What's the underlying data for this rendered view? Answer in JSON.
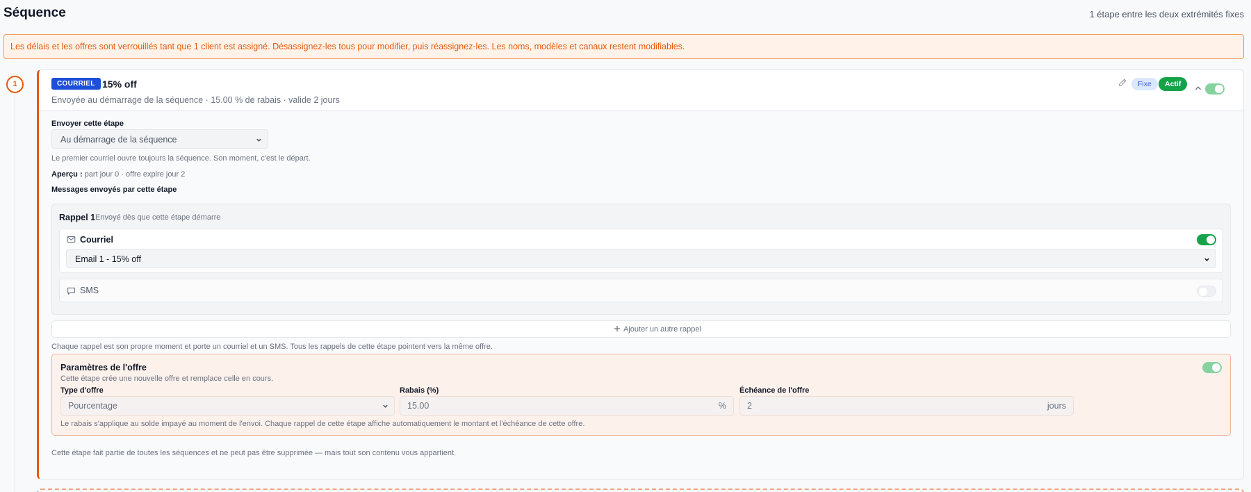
{
  "header": {
    "title": "Séquence",
    "meta": "1 étape entre les deux extrémités fixes"
  },
  "banner": {
    "text": "Les délais et les offres sont verrouillés tant que 1 client est assigné. Désassignez-les tous pour modifier, puis réassignez-les. Les noms, modèles et canaux restent modifiables."
  },
  "step": {
    "number": "1",
    "channel_badge": "COURRIEL",
    "title": "15% off",
    "subtitle": "Envoyée au démarrage de la séquence · 15.00 % de rabais · valide 2 jours",
    "tag_fixed": "Fixe",
    "tag_active": "Actif",
    "enabled": true,
    "send_label": "Envoyer cette étape",
    "send_select": "Au démarrage de la séquence",
    "send_hint": "Le premier courriel ouvre toujours la séquence. Son moment, c'est le départ.",
    "preview_label": "Aperçu :",
    "preview_value": "part jour 0 · offre expire jour 2",
    "messages_label": "Messages envoyés par cette étape",
    "rappel": {
      "title": "Rappel 1",
      "subtitle": "Envoyé dès que cette étape démarre",
      "email": {
        "label": "Courriel",
        "enabled": true,
        "template": "Email 1 - 15% off"
      },
      "sms": {
        "label": "SMS",
        "enabled": false
      }
    },
    "add_rappel": "Ajouter un autre rappel",
    "rappel_hint": "Chaque rappel est son propre moment et porte un courriel et un SMS. Tous les rappels de cette étape pointent vers la même offre.",
    "offer": {
      "title": "Paramètres de l'offre",
      "subtitle": "Cette étape crée une nouvelle offre et remplace celle en cours.",
      "enabled": true,
      "type_label": "Type d'offre",
      "type_value": "Pourcentage",
      "discount_label": "Rabais (%)",
      "discount_value": "15.00",
      "discount_unit": "%",
      "expiry_label": "Échéance de l'offre",
      "expiry_value": "2",
      "expiry_unit": "jours",
      "footer": "Le rabais s'applique au solde impayé au moment de l'envoi. Chaque rappel de cette étape affiche automatiquement le montant et l'échéance de cette offre."
    },
    "footer": "Cette étape fait partie de toutes les séquences et ne peut pas être supprimée — mais tout son contenu vous appartient."
  },
  "colors": {
    "accent": "#e8590c",
    "badge_blue": "#1d4ed8",
    "active_green": "#16a34a"
  }
}
